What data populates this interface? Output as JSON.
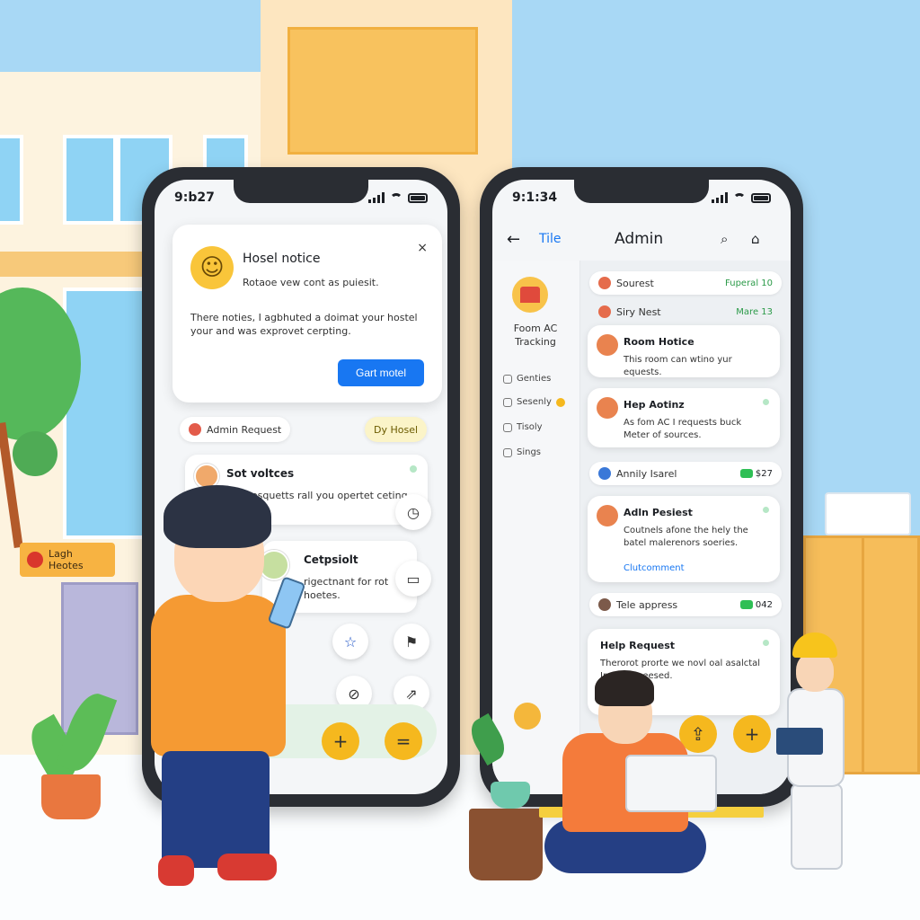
{
  "scene": {
    "shop_sign": "Lagh Heotes"
  },
  "left_phone": {
    "status_time": "9:b27",
    "notice": {
      "title": "Hosel notice",
      "close": "×",
      "subtitle": "Rotaoe vew cont as puiesit.",
      "body": "There noties, I agbhuted a doimat your hostel your and was exprovet cerpting.",
      "button": "Gart motel"
    },
    "chips": {
      "admin_request": "Admin Request",
      "dy_hosel": "Dy Hosel"
    },
    "messages": [
      {
        "title": "Sot voltces",
        "body": "rtor resquetts rall you opertet ceting."
      },
      {
        "title": "Cetpsiolt",
        "body": "rigectnant for rot hoetes."
      }
    ],
    "icons": {
      "clock": "◷",
      "inbox": "▭",
      "star": "☆",
      "flag": "⚑",
      "link": "⊘",
      "share": "⇗",
      "add": "+",
      "minus": "="
    }
  },
  "right_phone": {
    "status_time": "9:1:34",
    "header": {
      "back": "←",
      "tile": "Tile",
      "title": "Admin",
      "search_icon": "⌕",
      "cart_icon": "⌂"
    },
    "sidebar": {
      "title": "Foom AC Tracking",
      "items": [
        "Genties",
        "Sesenly",
        "Tisoly",
        "Sings"
      ]
    },
    "feed": {
      "rows": [
        {
          "text": "Sourest",
          "tag": "Fuperal  10"
        },
        {
          "text": "Siry Nest",
          "tag": "Mare 13"
        },
        {
          "text": "Annily Isarel",
          "badge": "$27"
        },
        {
          "text": "Tele appress",
          "badge": "042"
        }
      ],
      "cards": [
        {
          "title": "Room Hotice",
          "body": "This room can wtino yur equests."
        },
        {
          "title": "Hep Aotinz",
          "body": "As fom AC I requests buck Meter of sources."
        },
        {
          "title": "Adln Pesiest",
          "body": "Coutnels afone the hely the batel malerenors soeries.",
          "link": "Clutcomment"
        },
        {
          "title": "Help Request",
          "body": "Therorot prorte we novl oal asalctal Ire core peesed."
        }
      ],
      "fab_icons": [
        "⇪",
        "+"
      ]
    }
  }
}
